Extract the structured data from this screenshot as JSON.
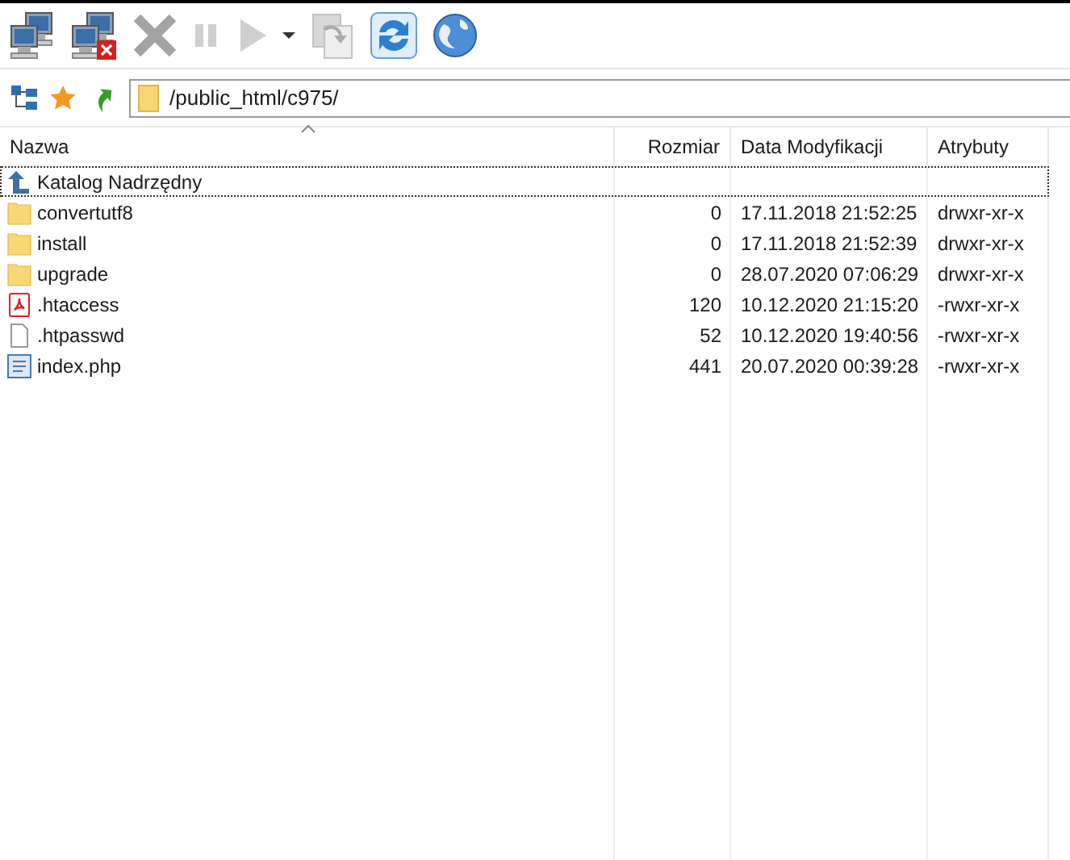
{
  "toolbar": [
    {
      "kind": "connect",
      "disabled": false
    },
    {
      "kind": "disconnect",
      "disabled": false
    },
    {
      "kind": "cancel",
      "disabled": true
    },
    {
      "kind": "pause",
      "disabled": true
    },
    {
      "kind": "play",
      "disabled": true
    },
    {
      "kind": "dropdown",
      "disabled": false
    },
    {
      "kind": "copy",
      "disabled": true
    },
    {
      "kind": "refresh",
      "disabled": false
    },
    {
      "kind": "globe",
      "disabled": false
    }
  ],
  "address": {
    "path": "/public_html/c975/"
  },
  "table": {
    "columns": [
      "Nazwa",
      "Rozmiar",
      "Data Modyfikacji",
      "Atrybuty"
    ],
    "rows": [
      {
        "kind": "parent",
        "focused": true,
        "name": "Katalog Nadrzędny"
      },
      {
        "kind": "folder",
        "focused": false,
        "name": "convertutf8",
        "size": "0",
        "date": "17.11.2018 21:52:25",
        "attrs": "drwxr-xr-x"
      },
      {
        "kind": "folder",
        "focused": false,
        "name": "install",
        "size": "0",
        "date": "17.11.2018 21:52:39",
        "attrs": "drwxr-xr-x"
      },
      {
        "kind": "folder",
        "focused": false,
        "name": "upgrade",
        "size": "0",
        "date": "28.07.2020 07:06:29",
        "attrs": "drwxr-xr-x"
      },
      {
        "kind": "pdf",
        "focused": false,
        "name": ".htaccess",
        "size": "120",
        "date": "10.12.2020 21:15:20",
        "attrs": "-rwxr-xr-x"
      },
      {
        "kind": "file",
        "focused": false,
        "name": ".htpasswd",
        "size": "52",
        "date": "10.12.2020 19:40:56",
        "attrs": "-rwxr-xr-x"
      },
      {
        "kind": "php",
        "focused": false,
        "name": "index.php",
        "size": "441",
        "date": "20.07.2020 00:39:28",
        "attrs": "-rwxr-xr-x"
      }
    ]
  }
}
